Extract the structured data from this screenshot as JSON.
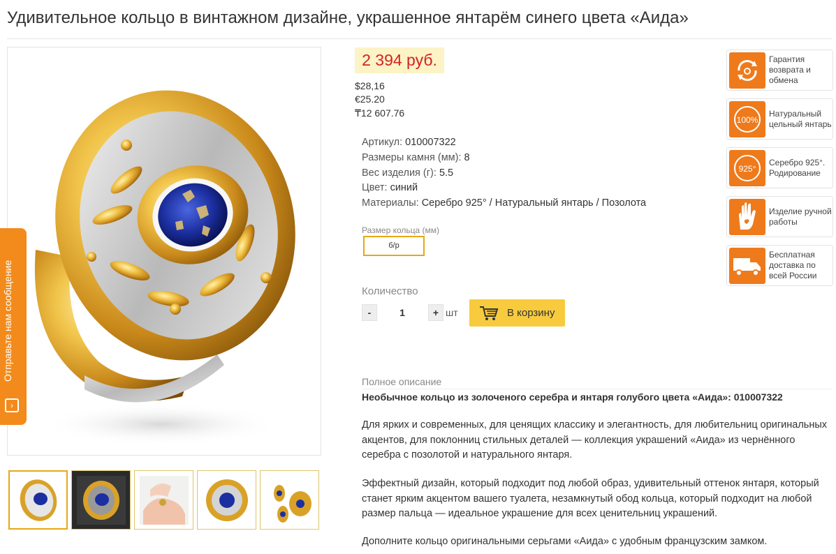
{
  "product": {
    "title": "Удивительное кольцо в винтажном дизайне, украшенное янтарём синего цвета «Аида»",
    "price": "2 394 руб.",
    "price_usd": "$28,16",
    "price_eur": "€25.20",
    "price_kzt": "₸12 607.76"
  },
  "specs": [
    {
      "label": "Артикул:",
      "value": "010007322"
    },
    {
      "label": "Размеры камня (мм):",
      "value": "8"
    },
    {
      "label": "Вес изделия (г):",
      "value": "5.5"
    },
    {
      "label": "Цвет:",
      "value": "синий"
    },
    {
      "label": "Материалы:",
      "value": "Серебро 925° / Натуральный янтарь / Позолота"
    }
  ],
  "ring_size": {
    "label": "Размер кольца (мм)",
    "option": "б/р"
  },
  "quantity": {
    "label": "Количество",
    "minus": "-",
    "plus": "+",
    "value": "1",
    "unit": "шт"
  },
  "cart_button": "В корзину",
  "feedback_tab": "Отправьте нам сообщение",
  "description": {
    "label": "Полное описание",
    "heading": "Необычное кольцо из золоченого серебра и янтаря голубого цвета «Аида»: 010007322",
    "paragraphs": [
      "Для ярких и современных, для ценящих классику и элегантность, для любительниц оригинальных акцентов, для поклонниц стильных деталей — коллекция украшений «Аида» из чернённого серебра с позолотой и натурального янтаря.",
      "Эффектный дизайн, который подходит под любой образ, удивительный оттенок янтаря, который станет ярким акцентом вашего туалета, незамкнутый обод кольца, который подходит на любой размер пальца — идеальное украшение для всех ценительниц украшений.",
      "Дополните кольцо оригинальными серьгами «Аида» с удобным французским замком."
    ]
  },
  "badges": [
    {
      "text": "Гарантия возврата и обмена",
      "icon": "return-icon"
    },
    {
      "text": "Натуральный цельный янтарь",
      "icon": "100-percent-icon",
      "icon_text": "100%"
    },
    {
      "text": "Серебро 925°. Родирование",
      "icon": "silver-925-icon",
      "icon_text": "925°"
    },
    {
      "text": "Изделие ручной работы",
      "icon": "hand-icon"
    },
    {
      "text": "Бесплатная доставка по всей России",
      "icon": "truck-icon"
    }
  ],
  "colors": {
    "accent": "#f28b1c",
    "price": "#d42222",
    "price_bg": "#fcf3c6",
    "cart": "#f8cb3f",
    "gold": "#d9a227",
    "amber_blue": "#1c2fa0"
  }
}
